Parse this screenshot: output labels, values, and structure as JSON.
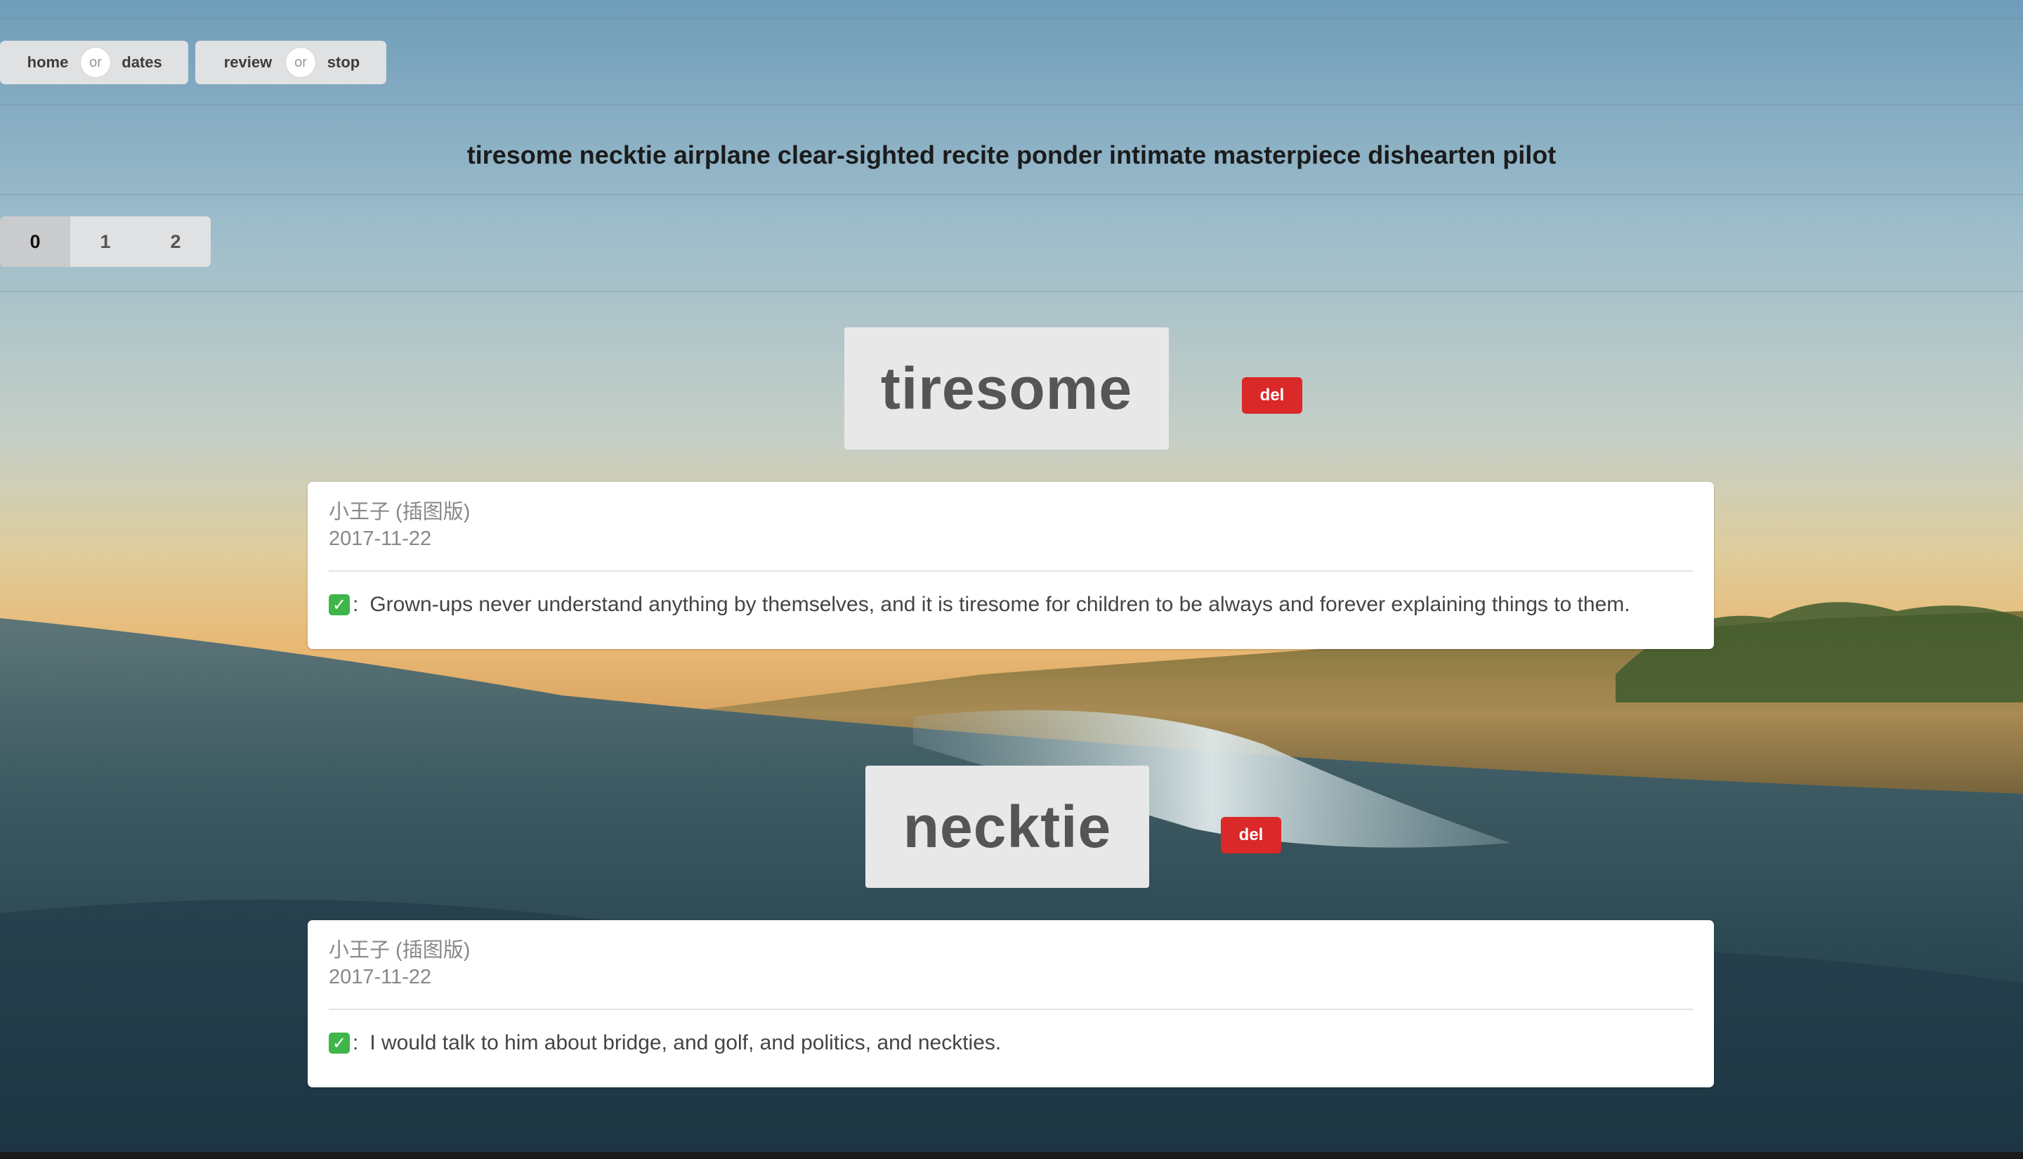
{
  "nav": {
    "group1": {
      "left": "home",
      "or": "or",
      "right": "dates"
    },
    "group2": {
      "left": "review",
      "or": "or",
      "right": "stop"
    }
  },
  "word_list": "tiresome necktie airplane clear-sighted recite ponder intimate masterpiece dishearten pilot",
  "tabs": [
    {
      "label": "0",
      "active": true
    },
    {
      "label": "1",
      "active": false
    },
    {
      "label": "2",
      "active": false
    }
  ],
  "entries": [
    {
      "word": "tiresome",
      "del_label": "del",
      "book": "小王子 (插图版)",
      "date": "2017-11-22",
      "check": "✓",
      "colon": ":",
      "sentence": "Grown-ups never understand anything by themselves, and it is tiresome for children to be always and forever explaining things to them."
    },
    {
      "word": "necktie",
      "del_label": "del",
      "book": "小王子 (插图版)",
      "date": "2017-11-22",
      "check": "✓",
      "colon": ":",
      "sentence": "I would talk to him about bridge, and golf, and politics, and neckties."
    }
  ],
  "colors": {
    "del": "#db2828",
    "button": "#e0e1e2",
    "active_tab": "#cacbcd",
    "check": "#3fb54a"
  }
}
